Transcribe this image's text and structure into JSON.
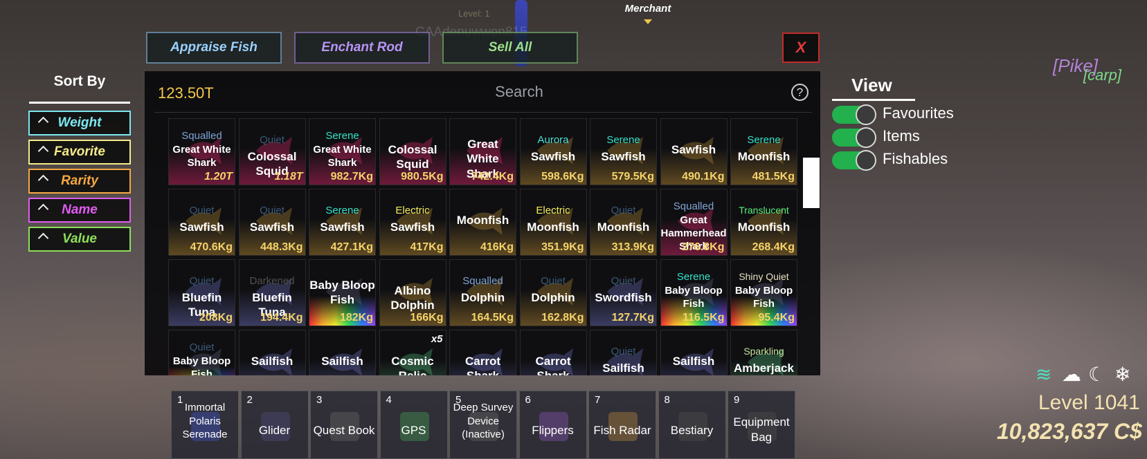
{
  "scene": {
    "level_faint": "Level: 1",
    "player_faint": "CAAdenuwwon815",
    "merchant": "Merchant",
    "floating_names": [
      "[Pike]",
      "[carp]"
    ]
  },
  "top_buttons": [
    {
      "label": "Appraise Fish",
      "color": "#9ad1ff"
    },
    {
      "label": "Enchant Rod",
      "color": "#b794f6"
    },
    {
      "label": "Sell All",
      "color": "#9be08a"
    }
  ],
  "close_label": "X",
  "sort": {
    "title": "Sort By",
    "options": [
      {
        "label": "Weight",
        "color": "#7de8f0"
      },
      {
        "label": "Favorite",
        "color": "#f5ec8a"
      },
      {
        "label": "Rarity",
        "color": "#f5a742"
      },
      {
        "label": "Name",
        "color": "#e05cf0"
      },
      {
        "label": "Value",
        "color": "#8ce05a"
      }
    ]
  },
  "inventory": {
    "money": "123.50T",
    "search_placeholder": "Search",
    "help": "?",
    "rows": [
      [
        {
          "mod": "Squalled",
          "mod_color": "#7fa4d6",
          "name": "Great White Shark",
          "weight": "1.20T",
          "accent": "#ff2d7a"
        },
        {
          "mod": "Quiet",
          "mod_color": "#3c5a78",
          "name": "Colossal Squid",
          "weight": "1.18T",
          "accent": "#ff2d7a"
        },
        {
          "mod": "Serene",
          "mod_color": "#35e2c6",
          "name": "Great White Shark",
          "weight": "982.7Kg",
          "accent": "#ff2d7a"
        },
        {
          "mod": "",
          "mod_color": "",
          "name": "Colossal Squid",
          "weight": "980.5Kg",
          "accent": "#ff2d7a"
        },
        {
          "mod": "",
          "mod_color": "",
          "name": "Great White Shark",
          "weight": "742.4Kg",
          "accent": "#ff2d7a"
        },
        {
          "mod": "Aurora",
          "mod_color": "#4ce0d4",
          "name": "Sawfish",
          "weight": "598.6Kg",
          "accent": "#d6a23a"
        },
        {
          "mod": "Serene",
          "mod_color": "#35e2c6",
          "name": "Sawfish",
          "weight": "579.5Kg",
          "accent": "#d6a23a"
        },
        {
          "mod": "",
          "mod_color": "",
          "name": "Sawfish",
          "weight": "490.1Kg",
          "accent": "#d6a23a"
        },
        {
          "mod": "Serene",
          "mod_color": "#35e2c6",
          "name": "Moonfish",
          "weight": "481.5Kg",
          "accent": "#d6a23a"
        }
      ],
      [
        {
          "mod": "Quiet",
          "mod_color": "#3c5a78",
          "name": "Sawfish",
          "weight": "470.6Kg",
          "accent": "#d6a23a"
        },
        {
          "mod": "Quiet",
          "mod_color": "#3c5a78",
          "name": "Sawfish",
          "weight": "448.3Kg",
          "accent": "#d6a23a"
        },
        {
          "mod": "Serene",
          "mod_color": "#35e2c6",
          "name": "Sawfish",
          "weight": "427.1Kg",
          "accent": "#d6a23a"
        },
        {
          "mod": "Electric",
          "mod_color": "#f5ec5a",
          "name": "Sawfish",
          "weight": "417Kg",
          "accent": "#d6a23a"
        },
        {
          "mod": "",
          "mod_color": "",
          "name": "Moonfish",
          "weight": "416Kg",
          "accent": "#d6a23a"
        },
        {
          "mod": "Electric",
          "mod_color": "#f5ec5a",
          "name": "Moonfish",
          "weight": "351.9Kg",
          "accent": "#d6a23a"
        },
        {
          "mod": "Quiet",
          "mod_color": "#3c5a78",
          "name": "Moonfish",
          "weight": "313.9Kg",
          "accent": "#d6a23a"
        },
        {
          "mod": "Squalled",
          "mod_color": "#7fa4d6",
          "name": "Great Hammerhead Shark",
          "weight": "276.8Kg",
          "accent": "#ff2d7a"
        },
        {
          "mod": "Translucent",
          "mod_color": "#5cf07a",
          "name": "Moonfish",
          "weight": "268.4Kg",
          "accent": "#d6a23a"
        }
      ],
      [
        {
          "mod": "Quiet",
          "mod_color": "#3c5a78",
          "name": "Bluefin Tuna",
          "weight": "208Kg",
          "accent": "#7b7fd8"
        },
        {
          "mod": "Darkened",
          "mod_color": "#505050",
          "name": "Bluefin Tuna",
          "weight": "194.4Kg",
          "accent": "#7b7fd8"
        },
        {
          "mod": "",
          "mod_color": "",
          "name": "Baby Bloop Fish",
          "weight": "182Kg",
          "accent": "#rainbow"
        },
        {
          "mod": "",
          "mod_color": "",
          "name": "Albino Dolphin",
          "weight": "166Kg",
          "accent": "#d6a23a"
        },
        {
          "mod": "Squalled",
          "mod_color": "#7fa4d6",
          "name": "Dolphin",
          "weight": "164.5Kg",
          "accent": "#d6a23a"
        },
        {
          "mod": "Quiet",
          "mod_color": "#3c5a78",
          "name": "Dolphin",
          "weight": "162.8Kg",
          "accent": "#d6a23a"
        },
        {
          "mod": "Quiet",
          "mod_color": "#3c5a78",
          "name": "Swordfish",
          "weight": "127.7Kg",
          "accent": "#7b7fd8"
        },
        {
          "mod": "Serene",
          "mod_color": "#35e2c6",
          "name": "Baby Bloop Fish",
          "weight": "116.5Kg",
          "accent": "#rainbow"
        },
        {
          "mod": "Shiny Quiet",
          "mod_color": "#e8e0c0",
          "name": "Baby Bloop Fish",
          "weight": "95.4Kg",
          "accent": "#rainbow"
        }
      ],
      [
        {
          "mod": "Quiet",
          "mod_color": "#3c5a78",
          "name": "Baby Bloop Fish",
          "weight": "",
          "accent": "#rainbow"
        },
        {
          "mod": "",
          "mod_color": "",
          "name": "Sailfish",
          "weight": "",
          "accent": "#7b7fd8"
        },
        {
          "mod": "",
          "mod_color": "",
          "name": "Sailfish",
          "weight": "",
          "accent": "#7b7fd8"
        },
        {
          "mod": "",
          "mod_color": "",
          "name": "Cosmic Relic",
          "weight": "",
          "count": "x5",
          "accent": "#5cd08a"
        },
        {
          "mod": "",
          "mod_color": "",
          "name": "Carrot Shark",
          "weight": "",
          "accent": "#7b7fd8"
        },
        {
          "mod": "",
          "mod_color": "",
          "name": "Carrot Shark",
          "weight": "",
          "accent": "#7b7fd8"
        },
        {
          "mod": "Quiet",
          "mod_color": "#3c5a78",
          "name": "Sailfish",
          "weight": "",
          "accent": "#7b7fd8"
        },
        {
          "mod": "",
          "mod_color": "",
          "name": "Sailfish",
          "weight": "",
          "accent": "#7b7fd8"
        },
        {
          "mod": "Sparkling",
          "mod_color": "#c5e89a",
          "name": "Amberjack",
          "weight": "",
          "accent": "#5cd08a"
        }
      ]
    ]
  },
  "view": {
    "title": "View",
    "toggles": [
      {
        "label": "Favourites",
        "on": true
      },
      {
        "label": "Items",
        "on": true
      },
      {
        "label": "Fishables",
        "on": true
      }
    ]
  },
  "hotbar": [
    {
      "num": "1",
      "label": "Immortal Polaris Serenade",
      "icon": "rod-icon"
    },
    {
      "num": "2",
      "label": "Glider",
      "icon": "glider-icon"
    },
    {
      "num": "3",
      "label": "Quest Book",
      "icon": "book-icon"
    },
    {
      "num": "4",
      "label": "GPS",
      "icon": "gps-icon"
    },
    {
      "num": "5",
      "label": "Deep Survey Device (Inactive)",
      "icon": "device-icon"
    },
    {
      "num": "6",
      "label": "Flippers",
      "icon": "flippers-icon"
    },
    {
      "num": "7",
      "label": "Fish Radar",
      "icon": "radar-icon"
    },
    {
      "num": "8",
      "label": "Bestiary",
      "icon": "bestiary-icon"
    },
    {
      "num": "9",
      "label": "Equipment Bag",
      "icon": "bag-icon"
    }
  ],
  "status": {
    "level": "Level 1041",
    "cash": "10,823,637 C$",
    "weather_icons": [
      "wind-icon",
      "no-cloud-icon",
      "moon-icon",
      "snowflake-icon"
    ]
  }
}
